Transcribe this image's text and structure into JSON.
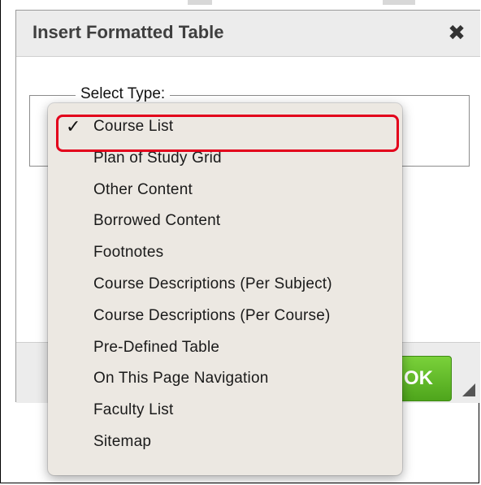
{
  "dialog": {
    "title": "Insert Formatted Table",
    "close_glyph": "✖",
    "fieldset_legend": "Select Type:",
    "ok_label": "OK"
  },
  "dropdown": {
    "selected_index": 0,
    "check_glyph": "✓",
    "items": [
      "Course List",
      "Plan of Study Grid",
      "Other Content",
      "Borrowed Content",
      "Footnotes",
      "Course Descriptions (Per Subject)",
      "Course Descriptions (Per Course)",
      "Pre-Defined Table",
      "On This Page Navigation",
      "Faculty List",
      "Sitemap"
    ]
  },
  "annotation": {
    "highlight_color": "#e3001b"
  },
  "colors": {
    "ok_button": "#5cb82a",
    "menu_bg": "#ece8e2"
  }
}
